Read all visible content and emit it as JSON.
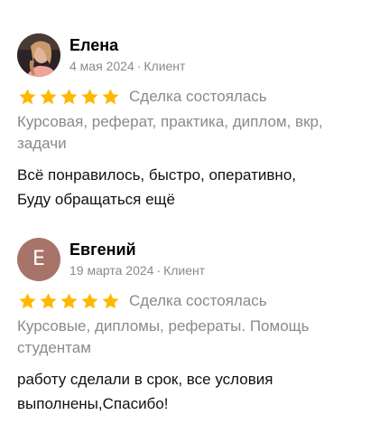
{
  "reviews": [
    {
      "name": "Елена",
      "date": "4 мая 2024",
      "separator": "·",
      "role": "Клиент",
      "avatar": "photo-avatar",
      "rating": 5,
      "rating_max": 5,
      "status": "Сделка состоялась",
      "category_line1": "Курсовая, реферат, практика, диплом, вкр,",
      "category_line2": "задачи",
      "text_line1": "Всё понравилось, быстро, оперативно,",
      "text_line2": "Буду обращаться ещё"
    },
    {
      "name": "Евгений",
      "date": "19 марта 2024",
      "separator": "·",
      "role": "Клиент",
      "avatar_letter": "Е",
      "avatar_color": "#a7746a",
      "rating": 5,
      "rating_max": 5,
      "status": "Сделка состоялась",
      "category_line1": "Курсовые, дипломы, рефераты. Помощь",
      "category_line2": "студентам",
      "text_line1": "работу сделали в срок, все условия",
      "text_line2": "выполнены,Спасибо!"
    }
  ],
  "colors": {
    "star": "#ffb800",
    "muted_text": "#8a8a8a"
  }
}
